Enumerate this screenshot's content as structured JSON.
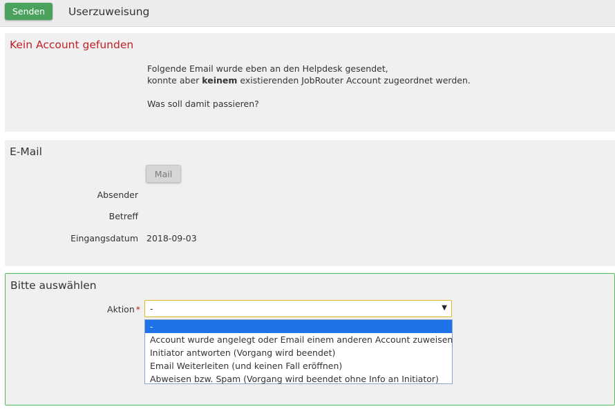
{
  "topbar": {
    "send_label": "Senden",
    "title": "Userzuweisung"
  },
  "panel_no_account": {
    "heading": "Kein Account gefunden",
    "line1": "Folgende Email wurde eben an den Helpdesk gesendet,",
    "line2_pre": "konnte aber ",
    "line2_bold": "keinem",
    "line2_post": " existierenden JobRouter Account zugeordnet werden.",
    "question": "Was soll damit passieren?"
  },
  "panel_email": {
    "heading": "E-Mail",
    "mail_button": "Mail",
    "sender_label": "Absender",
    "sender_value": "",
    "subject_label": "Betreff",
    "subject_value": "",
    "date_label": "Eingangsdatum",
    "date_value": "2018-09-03"
  },
  "panel_select": {
    "heading": "Bitte auswählen",
    "action_label": "Aktion",
    "required_mark": "*",
    "selected_value": "-",
    "caret": "▼",
    "options": [
      "-",
      "Account wurde angelegt oder Email einem anderen Account zuweisen",
      "Initiator antworten (Vorgang wird beendet)",
      "Email Weiterleiten (und keinen Fall eröffnen)",
      "Abweisen bzw. Spam (Vorgang wird beendet ohne Info an Initiator)"
    ]
  },
  "colors": {
    "send_button": "#4aa25d",
    "error_heading": "#c12127",
    "selected_option": "#1e73e8",
    "select_border": "#e4b41f",
    "panel_border": "#52b75a"
  }
}
